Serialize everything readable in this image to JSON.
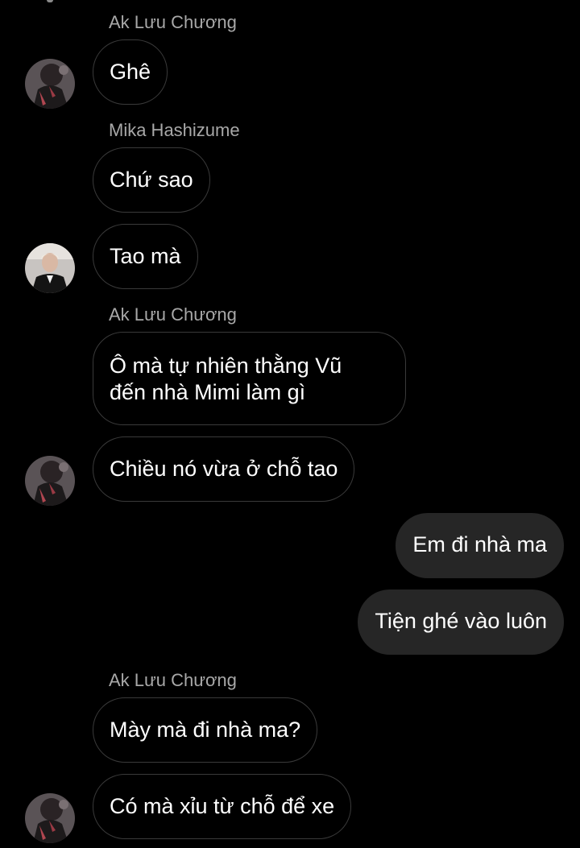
{
  "thread": {
    "senders": {
      "ak_1": "Ak Lưu Chương",
      "mika": "Mika Hashizume",
      "ak_2": "Ak Lưu Chương",
      "ak_3": "Ak Lưu Chương"
    },
    "messages": {
      "m1": "Ghê",
      "m2": "Chứ sao",
      "m3": "Tao mà",
      "m4_line1": "Ô mà tự nhiên thằng Vũ",
      "m4_line2": "đến nhà Mimi làm gì",
      "m5": "Chiều nó vừa ở chỗ tao",
      "m6": "Em đi nhà ma",
      "m7": "Tiện ghé vào luôn",
      "m8": "Mày mà đi nhà ma?",
      "m9": "Có mà xỉu từ chỗ để xe"
    },
    "colors": {
      "background": "#000000",
      "incoming_border": "#3a3a3a",
      "outgoing_fill": "#262626",
      "sender_name": "#a8a8a8",
      "text": "#ffffff"
    }
  }
}
